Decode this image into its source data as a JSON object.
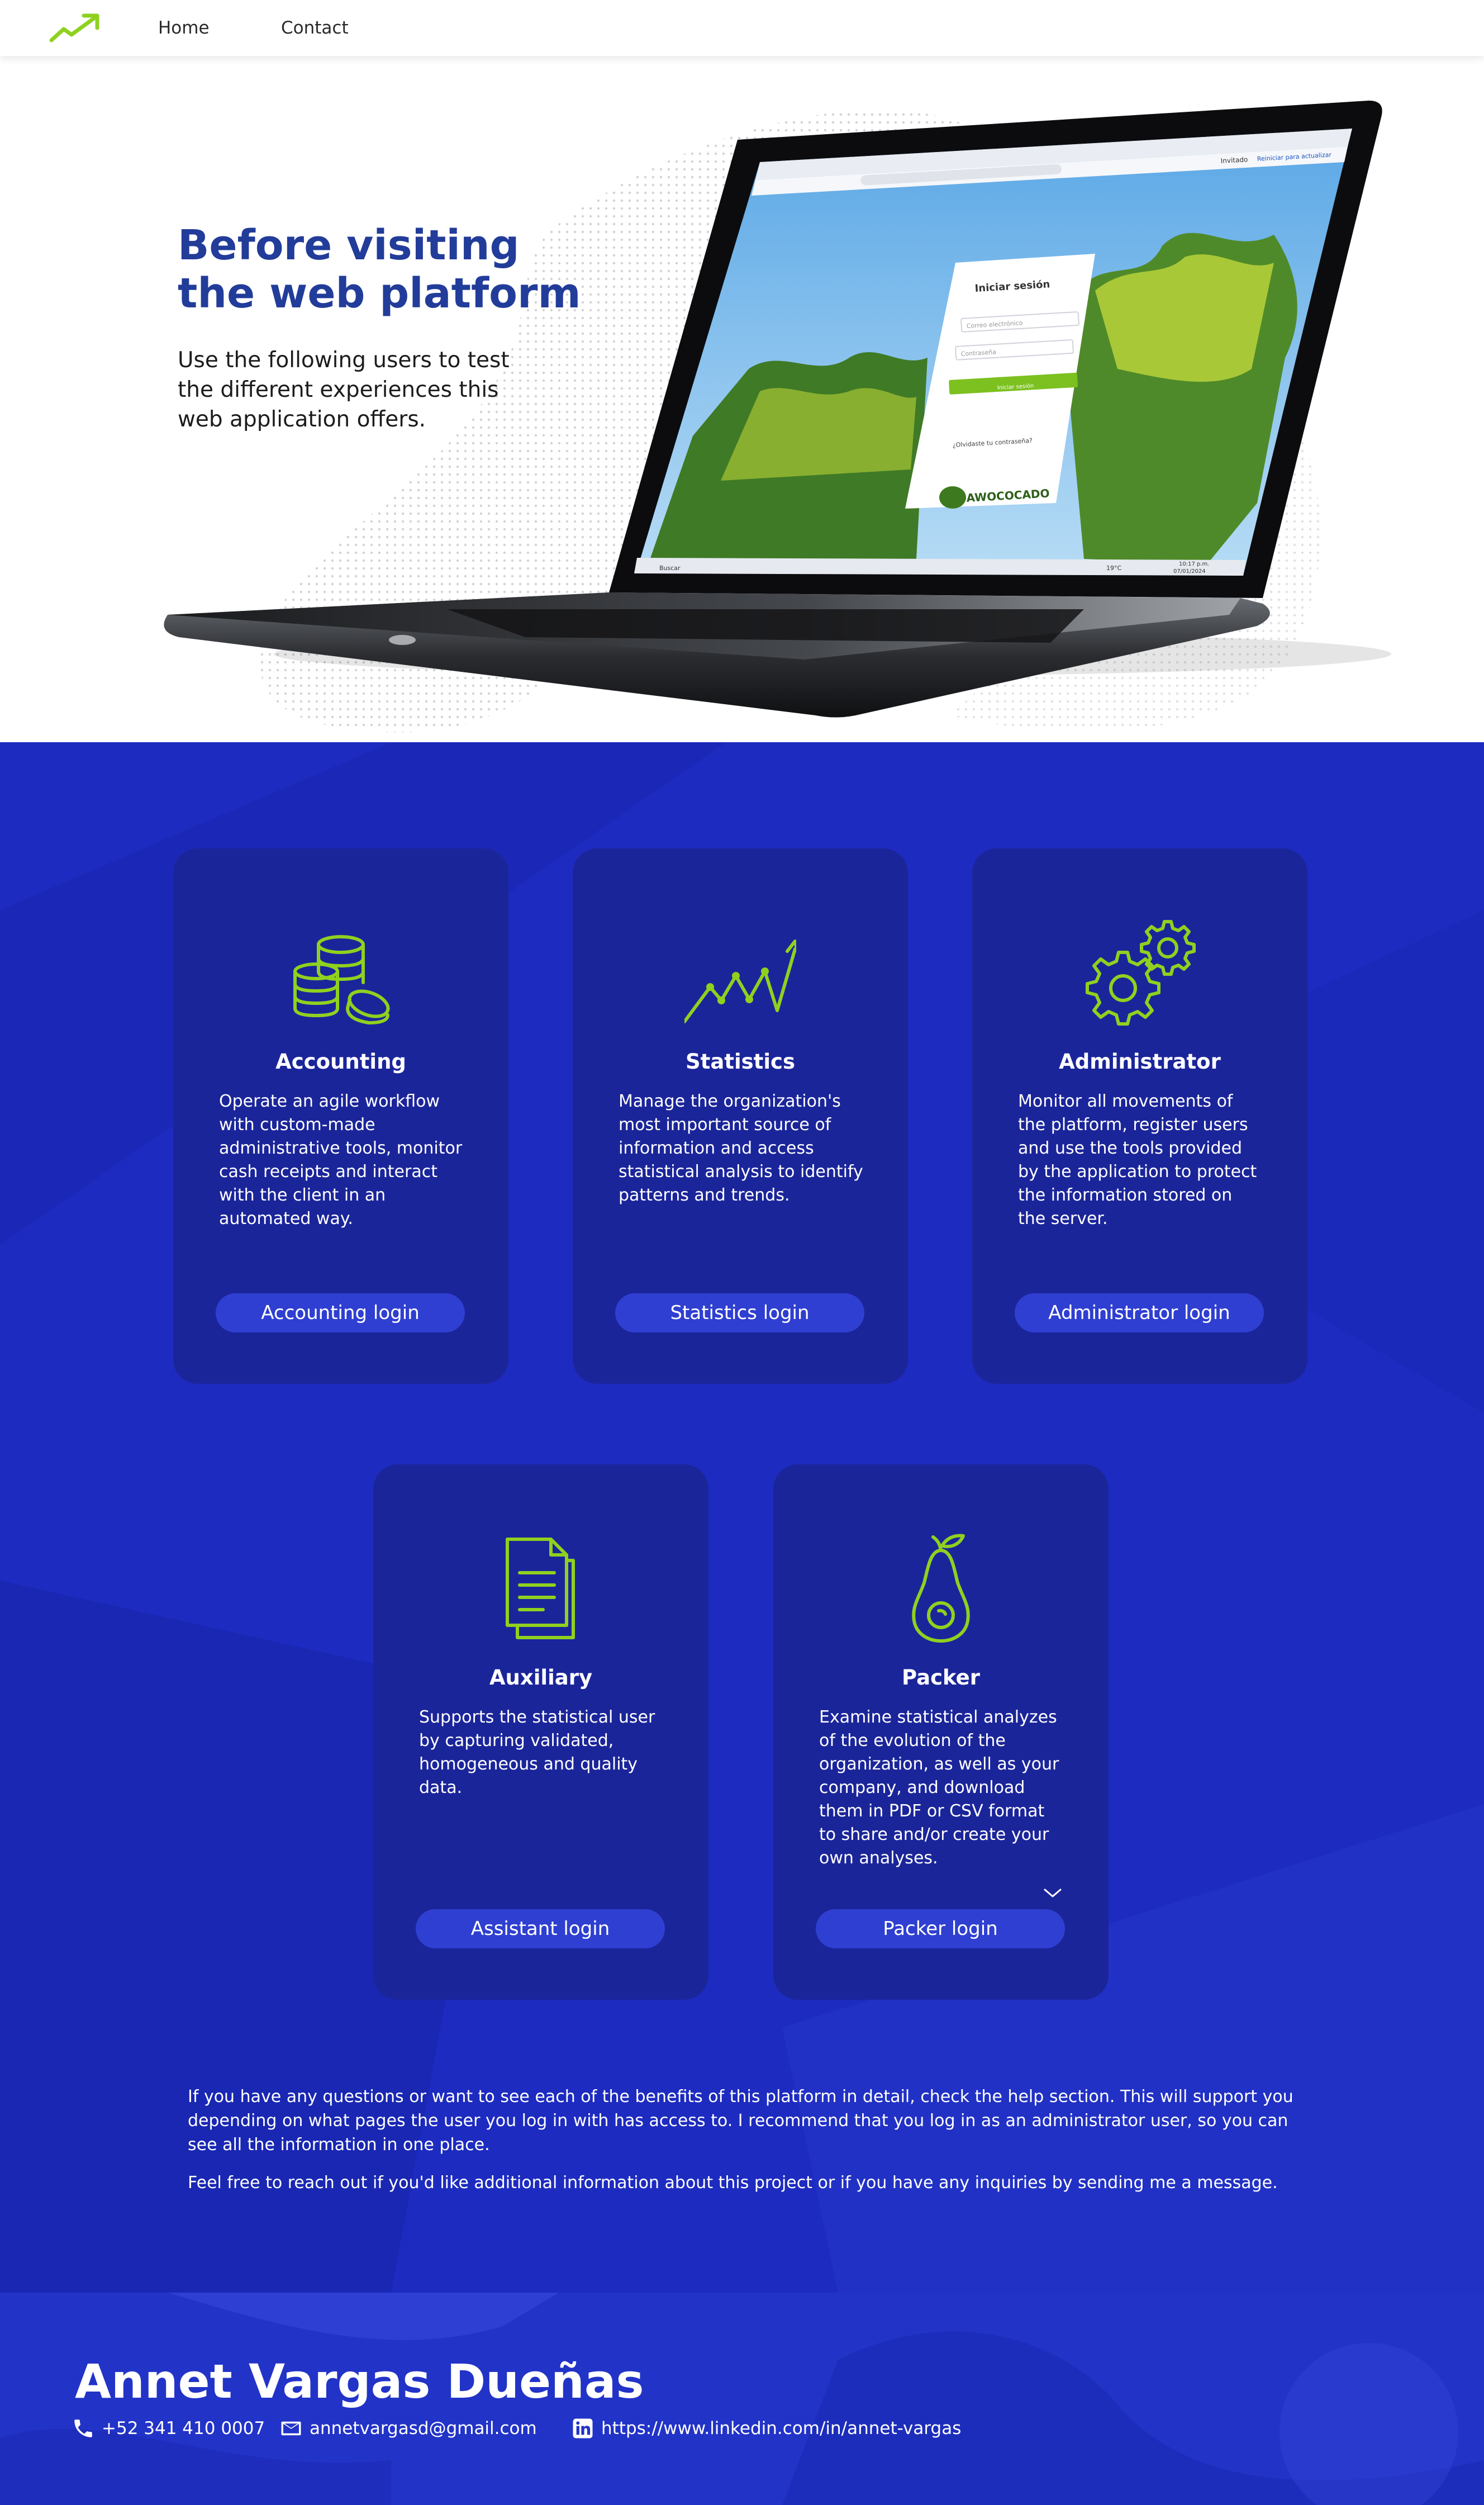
{
  "nav": {
    "logo_icon": "trending-up-icon",
    "home_label": "Home",
    "contact_label": "Contact"
  },
  "hero": {
    "title_line1": "Before visiting",
    "title_line2": "the web platform",
    "subtitle": "Use the following users to test the different experiences this web application offers.",
    "screen": {
      "login_title": "Iniciar sesión",
      "email_placeholder": "Correo electrónico",
      "password_placeholder": "Contraseña",
      "login_button": "Iniciar sesión",
      "forgot": "¿Olvidaste tu contraseña?",
      "brand": "AWOCOCADO",
      "taskbar_search": "Buscar",
      "time": "10:17 p.m.",
      "date": "07/01/2024",
      "temp": "19°C",
      "browser_update": "Reiniciar para actualizar",
      "browser_profile": "Invitado"
    }
  },
  "cards": [
    {
      "icon": "coins-icon",
      "title": "Accounting",
      "description": "Operate an agile workflow with custom-made administrative tools, monitor cash receipts and interact with the client in an automated way.",
      "button": "Accounting login"
    },
    {
      "icon": "trend-line-icon",
      "title": "Statistics",
      "description": "Manage the organization's most important source of information and access statistical analysis to identify patterns and trends.",
      "button": "Statistics login"
    },
    {
      "icon": "gears-icon",
      "title": "Administrator",
      "description": "Monitor all movements of the platform, register users and use the tools provided by the application to protect the information stored on the server.",
      "button": "Administrator login"
    },
    {
      "icon": "document-icon",
      "title": "Auxiliary",
      "description": "Supports the statistical user by capturing validated, homogeneous and quality data.",
      "button": "Assistant login"
    },
    {
      "icon": "avocado-icon",
      "title": "Packer",
      "description": "Examine statistical analyzes of the evolution of the organization, as well as your company, and download them in PDF or CSV format to share and/or create your own analyses.",
      "button": "Packer login"
    }
  ],
  "info": {
    "paragraph1": "If you have any questions or want to see each of the benefits of this platform in detail, check the help section. This will support you depending on what pages the user you log in with has access to. I recommend that you log in as an administrator user, so you can see all the information in one place.",
    "paragraph2": "Feel free to reach out if you'd like additional information about this project or if you have any inquiries by sending me a message."
  },
  "footer": {
    "name": "Annet Vargas Dueñas",
    "phone": "+52 341 410 0007",
    "email": "annetvargasd@gmail.com",
    "linkedin": "https://www.linkedin.com/in/annet-vargas"
  },
  "colors": {
    "accent_green": "#8fd11f",
    "hero_title": "#223c9a",
    "section_blue": "#1d2bc0",
    "card_blue": "#1b259a",
    "button_blue": "#2f3fd1"
  }
}
